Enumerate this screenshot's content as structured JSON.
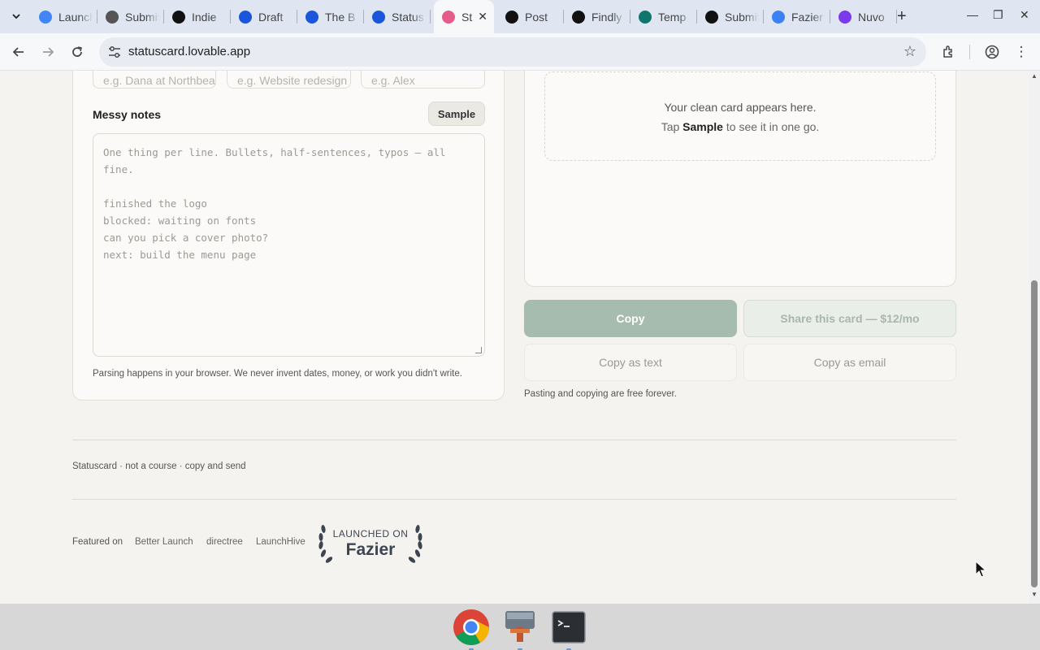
{
  "browser": {
    "tabs": [
      {
        "title": "Launch",
        "favicon": "google-icon",
        "color": "#4285f4"
      },
      {
        "title": "Submit",
        "favicon": "globe-icon",
        "color": "#555555"
      },
      {
        "title": "Indie",
        "favicon": "ih-icon",
        "color": "#111111"
      },
      {
        "title": "Draft",
        "favicon": "circle-logo-icon",
        "color": "#1a56db"
      },
      {
        "title": "The B",
        "favicon": "diamond-icon",
        "color": "#1a56db"
      },
      {
        "title": "Status",
        "favicon": "diamond-icon",
        "color": "#1a56db"
      },
      {
        "title": "St",
        "favicon": "lovable-icon",
        "color": "#e55b8a",
        "active": true
      },
      {
        "title": "Post",
        "favicon": "square-logo-icon",
        "color": "#111111"
      },
      {
        "title": "Findly",
        "favicon": "ft-icon",
        "color": "#111111"
      },
      {
        "title": "Temp",
        "favicon": "round-logo-icon",
        "color": "#0f766e"
      },
      {
        "title": "Submit",
        "favicon": "ft-icon",
        "color": "#111111"
      },
      {
        "title": "Fazier",
        "favicon": "fazier-icon",
        "color": "#3b82f6"
      },
      {
        "title": "Nuvo",
        "favicon": "heart-icon",
        "color": "#7c3aed"
      }
    ],
    "url": "statuscard.lovable.app"
  },
  "form": {
    "inputs": [
      {
        "placeholder": "e.g. Dana at Northbeam"
      },
      {
        "placeholder": "e.g. Website redesign"
      },
      {
        "placeholder": "e.g. Alex"
      }
    ],
    "notes_label": "Messy notes",
    "sample_label": "Sample",
    "notes_placeholder": "One thing per line. Bullets, half-sentences, typos — all fine.\n\nfinished the logo\nblocked: waiting on fonts\ncan you pick a cover photo?\nnext: build the menu page",
    "parse_note": "Parsing happens in your browser. We never invent dates, money, or work you didn't write."
  },
  "preview": {
    "line1": "Your clean card appears here.",
    "line2_pre": "Tap",
    "line2_bold": "Sample",
    "line2_post": "to see it in one go."
  },
  "actions": {
    "copy": "Copy",
    "share": "Share this card — $12/mo",
    "copy_text": "Copy as text",
    "copy_email": "Copy as email",
    "free_note": "Pasting and copying are free forever."
  },
  "footer": {
    "tagline": "Statuscard · not a course · copy and send",
    "featured_on": "Featured on",
    "links": [
      "Better Launch",
      "directree",
      "LaunchHive"
    ],
    "badge_top": "LAUNCHED ON",
    "badge_name": "Fazier"
  },
  "taskbar": {
    "apps": [
      "chrome-icon",
      "app-window-icon",
      "terminal-icon"
    ]
  }
}
